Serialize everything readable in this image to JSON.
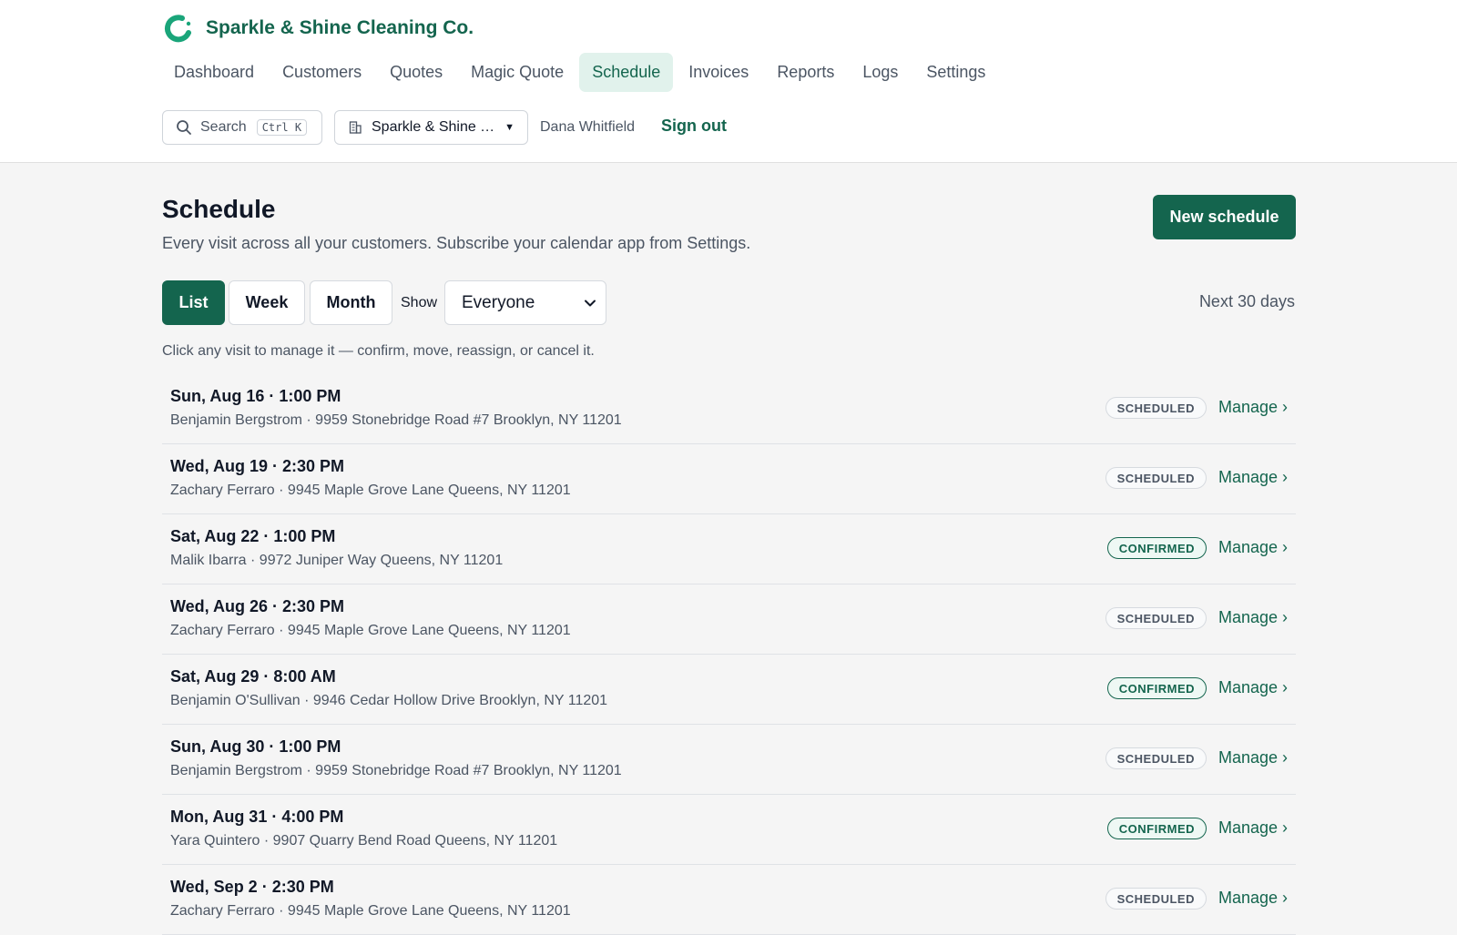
{
  "app": {
    "name": "Sparkle & Shine Cleaning Co.",
    "logo_icon": "crescent-logo-icon",
    "brand_color": "#14654e"
  },
  "nav": {
    "items": [
      {
        "label": "Dashboard"
      },
      {
        "label": "Customers"
      },
      {
        "label": "Quotes"
      },
      {
        "label": "Magic Quote"
      },
      {
        "label": "Schedule",
        "active": true
      },
      {
        "label": "Invoices"
      },
      {
        "label": "Reports"
      },
      {
        "label": "Logs"
      },
      {
        "label": "Settings"
      }
    ]
  },
  "search": {
    "label": "Search",
    "shortcut": "Ctrl K",
    "icon": "search-icon"
  },
  "org_select": {
    "value": "Sparkle & Shine …",
    "icon": "building-icon"
  },
  "user": {
    "name": "Dana Whitfield",
    "sign_out": "Sign out"
  },
  "page": {
    "title": "Schedule",
    "subtitle": "Every visit across all your customers. Subscribe your calendar app from Settings.",
    "new_button": "New schedule"
  },
  "views": {
    "list": "List",
    "week": "Week",
    "month": "Month",
    "active": "List"
  },
  "filter": {
    "show_label": "Show",
    "show_value": "Everyone",
    "range": "Next 30 days"
  },
  "hint": "Click any visit to manage it — confirm, move, reassign, or cancel it.",
  "visits": [
    {
      "when": "Sun, Aug 16 · 1:00 PM",
      "where": "Benjamin Bergstrom · 9959 Stonebridge Road #7 Brooklyn, NY 11201",
      "status": "SCHEDULED",
      "action": "Manage ›"
    },
    {
      "when": "Wed, Aug 19 · 2:30 PM",
      "where": "Zachary Ferraro · 9945 Maple Grove Lane Queens, NY 11201",
      "status": "SCHEDULED",
      "action": "Manage ›"
    },
    {
      "when": "Sat, Aug 22 · 1:00 PM",
      "where": "Malik Ibarra · 9972 Juniper Way Queens, NY 11201",
      "status": "CONFIRMED",
      "action": "Manage ›"
    },
    {
      "when": "Wed, Aug 26 · 2:30 PM",
      "where": "Zachary Ferraro · 9945 Maple Grove Lane Queens, NY 11201",
      "status": "SCHEDULED",
      "action": "Manage ›"
    },
    {
      "when": "Sat, Aug 29 · 8:00 AM",
      "where": "Benjamin O'Sullivan · 9946 Cedar Hollow Drive Brooklyn, NY 11201",
      "status": "CONFIRMED",
      "action": "Manage ›"
    },
    {
      "when": "Sun, Aug 30 · 1:00 PM",
      "where": "Benjamin Bergstrom · 9959 Stonebridge Road #7 Brooklyn, NY 11201",
      "status": "SCHEDULED",
      "action": "Manage ›"
    },
    {
      "when": "Mon, Aug 31 · 4:00 PM",
      "where": "Yara Quintero · 9907 Quarry Bend Road Queens, NY 11201",
      "status": "CONFIRMED",
      "action": "Manage ›"
    },
    {
      "when": "Wed, Sep 2 · 2:30 PM",
      "where": "Zachary Ferraro · 9945 Maple Grove Lane Queens, NY 11201",
      "status": "SCHEDULED",
      "action": "Manage ›"
    }
  ]
}
